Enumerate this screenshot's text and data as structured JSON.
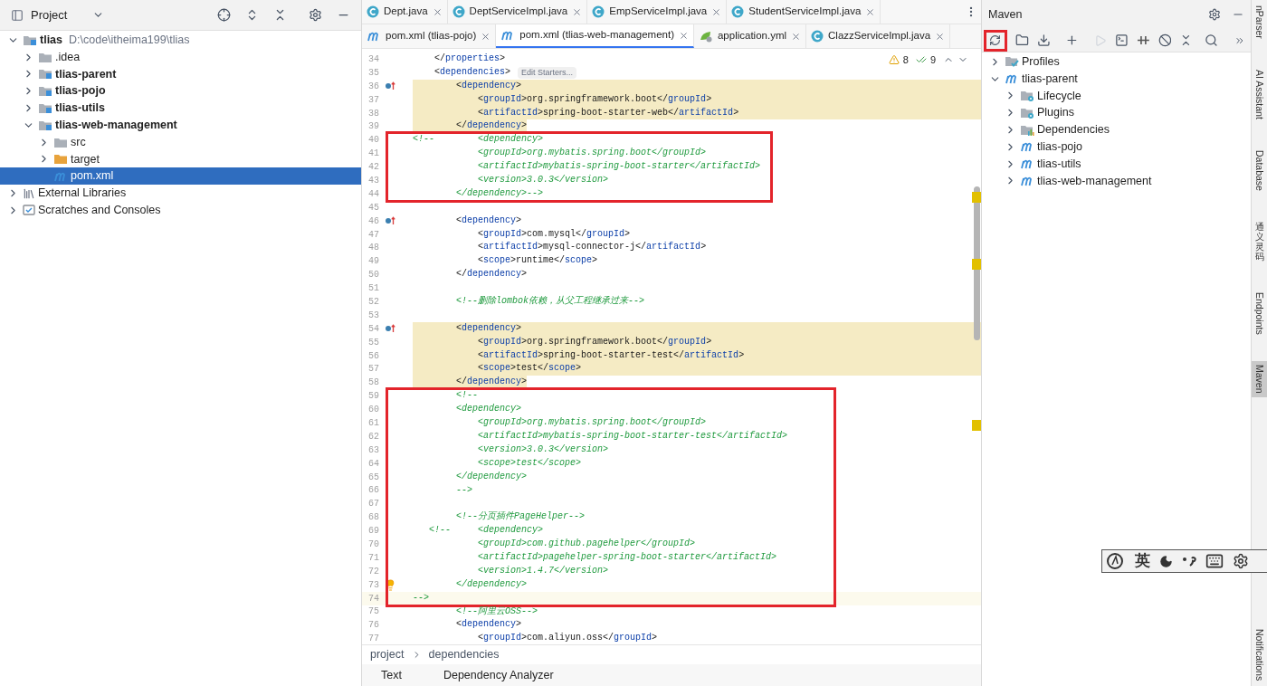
{
  "project_panel": {
    "title": "Project",
    "tree": [
      {
        "label": "tlias",
        "path": "D:\\code\\itheima199\\tlias",
        "kind": "module",
        "expanded": true,
        "selected": false,
        "children": [
          {
            "label": ".idea",
            "kind": "folder",
            "expanded": false,
            "selected": false
          },
          {
            "label": "tlias-parent",
            "kind": "module",
            "expanded": false,
            "selected": false
          },
          {
            "label": "tlias-pojo",
            "kind": "module",
            "expanded": false,
            "selected": false
          },
          {
            "label": "tlias-utils",
            "kind": "module",
            "expanded": false,
            "selected": false
          },
          {
            "label": "tlias-web-management",
            "kind": "module",
            "expanded": true,
            "selected": false,
            "children": [
              {
                "label": "src",
                "kind": "folder",
                "expanded": false,
                "selected": false
              },
              {
                "label": "target",
                "kind": "excluded",
                "expanded": false,
                "selected": false
              },
              {
                "label": "pom.xml",
                "kind": "maven",
                "selected": true
              }
            ]
          }
        ]
      },
      {
        "label": "External Libraries",
        "kind": "library",
        "expanded": false,
        "selected": false
      },
      {
        "label": "Scratches and Consoles",
        "kind": "scratches",
        "expanded": false,
        "selected": false
      }
    ]
  },
  "editor": {
    "tab_rows": [
      [
        {
          "label": "Dept.java",
          "kind": "class",
          "selected": false
        },
        {
          "label": "DeptServiceImpl.java",
          "kind": "class",
          "selected": false
        },
        {
          "label": "EmpServiceImpl.java",
          "kind": "class",
          "selected": false
        },
        {
          "label": "StudentServiceImpl.java",
          "kind": "class",
          "selected": false
        }
      ],
      [
        {
          "label": "pom.xml (tlias-pojo)",
          "kind": "maven",
          "selected": false
        },
        {
          "label": "pom.xml (tlias-web-management)",
          "kind": "maven",
          "selected": true
        },
        {
          "label": "application.yml",
          "kind": "yaml",
          "selected": false
        },
        {
          "label": "ClazzServiceImpl.java",
          "kind": "class",
          "selected": false
        }
      ]
    ],
    "inspections": {
      "warnings": "8",
      "passed": "9"
    },
    "blocks": [
      {
        "boxed": false,
        "lines": [
          {
            "num": "34",
            "kind": "tag",
            "text": "    </properties>"
          },
          {
            "num": "35",
            "kind": "tag",
            "text": "    <dependencies>",
            "hint": "Edit Starters..."
          },
          {
            "num": "36",
            "kind": "tag",
            "text": "        <dependency>",
            "highlighted": true,
            "highlight_full": true,
            "override_marker": true
          },
          {
            "num": "37",
            "kind": "tag",
            "text": "            <groupId>org.springframework.boot</groupId>",
            "highlighted": true,
            "highlight_full": true
          },
          {
            "num": "38",
            "kind": "tag",
            "text": "            <artifactId>spring-boot-starter-web</artifactId>",
            "highlighted": true,
            "highlight_full": true
          },
          {
            "num": "39",
            "kind": "tag",
            "text": "        </dependency>",
            "highlighted": true,
            "highlight_full": false
          }
        ]
      },
      {
        "boxed": true,
        "lines": [
          {
            "num": "40",
            "kind": "comment",
            "text": "<!--        <dependency>"
          },
          {
            "num": "41",
            "kind": "comment",
            "text": "            <groupId>org.mybatis.spring.boot</groupId>"
          },
          {
            "num": "42",
            "kind": "comment",
            "text": "            <artifactId>mybatis-spring-boot-starter</artifactId>"
          },
          {
            "num": "43",
            "kind": "comment",
            "text": "            <version>3.0.3</version>"
          },
          {
            "num": "44",
            "kind": "comment",
            "text": "        </dependency>-->"
          }
        ]
      },
      {
        "boxed": false,
        "lines": [
          {
            "num": "45"
          },
          {
            "num": "46",
            "kind": "tag",
            "text": "        <dependency>",
            "override_marker": true
          },
          {
            "num": "47",
            "kind": "tag",
            "text": "            <groupId>com.mysql</groupId>"
          },
          {
            "num": "48",
            "kind": "tag",
            "text": "            <artifactId>mysql-connector-j</artifactId>"
          },
          {
            "num": "49",
            "kind": "tag",
            "text": "            <scope>runtime</scope>"
          },
          {
            "num": "50",
            "kind": "tag",
            "text": "        </dependency>"
          },
          {
            "num": "51"
          },
          {
            "num": "52",
            "kind": "comment",
            "text": "        <!--删除lombok依赖，从父工程继承过来-->"
          },
          {
            "num": "53"
          },
          {
            "num": "54",
            "kind": "tag",
            "text": "        <dependency>",
            "highlighted": true,
            "highlight_full": true,
            "override_marker": true
          },
          {
            "num": "55",
            "kind": "tag",
            "text": "            <groupId>org.springframework.boot</groupId>",
            "highlighted": true,
            "highlight_full": true
          },
          {
            "num": "56",
            "kind": "tag",
            "text": "            <artifactId>spring-boot-starter-test</artifactId>",
            "highlighted": true,
            "highlight_full": true
          },
          {
            "num": "57",
            "kind": "tag",
            "text": "            <scope>test</scope>",
            "highlighted": true,
            "highlight_full": true
          },
          {
            "num": "58",
            "kind": "tag",
            "text": "        </dependency>",
            "highlighted": true,
            "highlight_full": false
          }
        ]
      },
      {
        "boxed": true,
        "lines": [
          {
            "num": "59",
            "kind": "comment",
            "text": "        <!--"
          },
          {
            "num": "60",
            "kind": "comment",
            "text": "        <dependency>"
          },
          {
            "num": "61",
            "kind": "comment",
            "text": "            <groupId>org.mybatis.spring.boot</groupId>"
          },
          {
            "num": "62",
            "kind": "comment",
            "text": "            <artifactId>mybatis-spring-boot-starter-test</artifactId>"
          },
          {
            "num": "63",
            "kind": "comment",
            "text": "            <version>3.0.3</version>"
          },
          {
            "num": "64",
            "kind": "comment",
            "text": "            <scope>test</scope>"
          },
          {
            "num": "65",
            "kind": "comment",
            "text": "        </dependency>"
          },
          {
            "num": "66",
            "kind": "comment",
            "text": "        -->"
          },
          {
            "num": "67"
          },
          {
            "num": "68",
            "kind": "comment",
            "text": "        <!--分页插件PageHelper-->"
          },
          {
            "num": "69",
            "kind": "comment",
            "text": "   <!--     <dependency>"
          },
          {
            "num": "70",
            "kind": "comment",
            "text": "            <groupId>com.github.pagehelper</groupId>"
          },
          {
            "num": "71",
            "kind": "comment",
            "text": "            <artifactId>pagehelper-spring-boot-starter</artifactId>"
          },
          {
            "num": "72",
            "kind": "comment",
            "text": "            <version>1.4.7</version>"
          },
          {
            "num": "73",
            "kind": "comment",
            "text": "        </dependency>",
            "bulb": true
          },
          {
            "num": "74",
            "kind": "comment",
            "text": "-->",
            "current": true
          }
        ]
      },
      {
        "boxed": false,
        "lines": [
          {
            "num": "75",
            "kind": "comment",
            "text": "        <!--阿里云OSS-->"
          },
          {
            "num": "76",
            "kind": "tag",
            "text": "        <dependency>"
          },
          {
            "num": "77",
            "kind": "tag",
            "text": "            <groupId>com.aliyun.oss</groupId>"
          }
        ]
      }
    ],
    "breadcrumb": [
      "project",
      "dependencies"
    ],
    "bottom_tabs": [
      "Text",
      "Dependency Analyzer"
    ]
  },
  "maven_panel": {
    "title": "Maven",
    "reload_marked": true,
    "tree": [
      {
        "label": "Profiles",
        "kind": "profiles",
        "expanded": false
      },
      {
        "label": "tlias-parent",
        "kind": "module",
        "expanded": true,
        "children": [
          {
            "label": "Lifecycle",
            "kind": "lifecycle",
            "expanded": false
          },
          {
            "label": "Plugins",
            "kind": "plugins",
            "expanded": false
          },
          {
            "label": "Dependencies",
            "kind": "dependencies",
            "expanded": false
          },
          {
            "label": "tlias-pojo",
            "kind": "module",
            "expanded": false
          },
          {
            "label": "tlias-utils",
            "kind": "module",
            "expanded": false
          },
          {
            "label": "tlias-web-management",
            "kind": "module",
            "expanded": false
          }
        ]
      }
    ]
  },
  "side_strip": [
    {
      "label": "nParser",
      "selected": false
    },
    {
      "label": "AI Assistant",
      "selected": false
    },
    {
      "label": "Database",
      "selected": false
    },
    {
      "label": "通义灵码",
      "cjk": true,
      "selected": false
    },
    {
      "label": "Endpoints",
      "selected": false
    },
    {
      "label": "Maven",
      "selected": true
    },
    {
      "label": "Notifications",
      "selected": false
    }
  ],
  "ime_bar": {
    "mode": "英"
  }
}
